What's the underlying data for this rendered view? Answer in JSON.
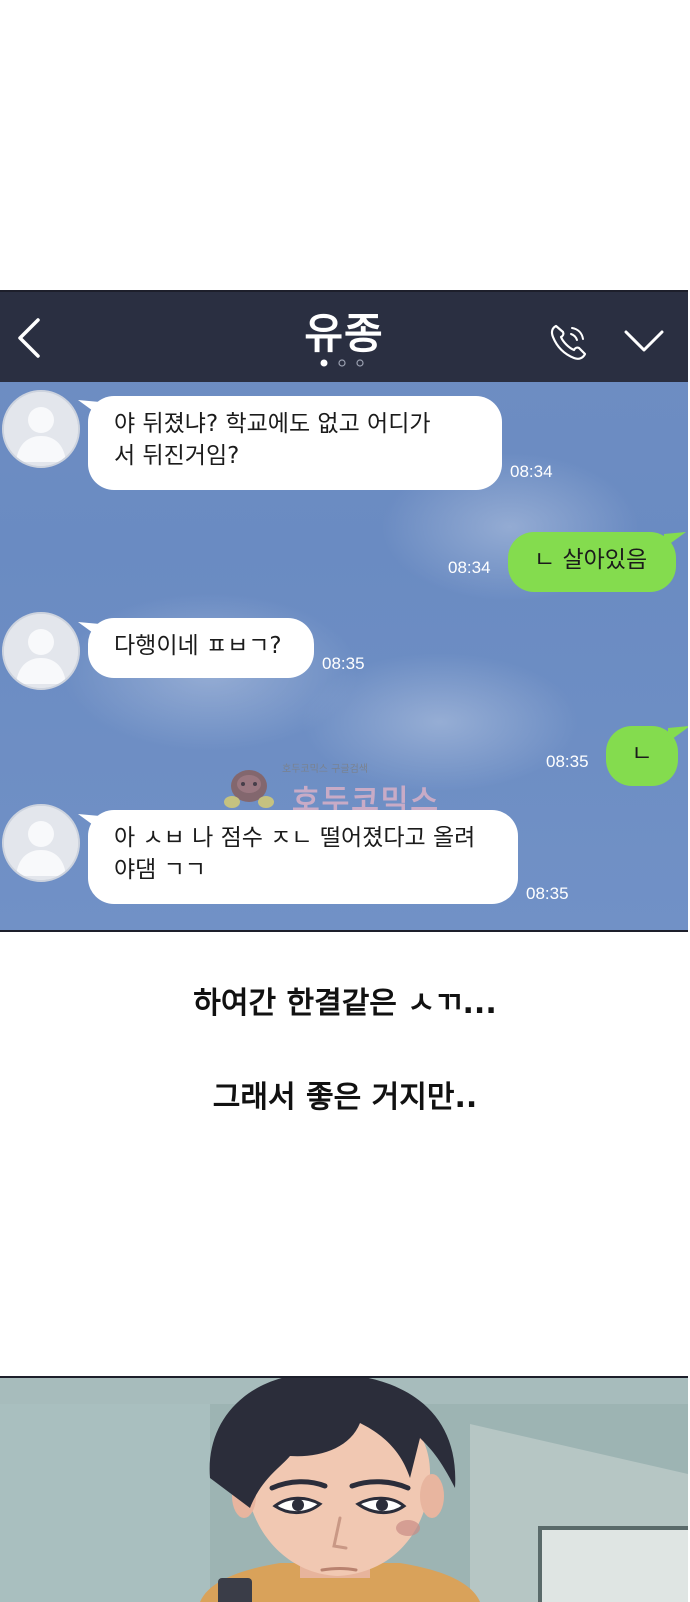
{
  "chat": {
    "title": "유종",
    "icons": {
      "back": "back-arrow-icon",
      "call": "phone-icon",
      "menu": "chevron-down-icon",
      "pages": "page-indicator-dots"
    },
    "messages": [
      {
        "side": "left",
        "text_lines": [
          "야 뒤졌냐? 학교에도 없고 어디가",
          "서 뒤진거임?"
        ],
        "time": "08:34"
      },
      {
        "side": "right",
        "text": "ㄴ 살아있음",
        "time": "08:34"
      },
      {
        "side": "left",
        "text": "다행이네 ㅍㅂㄱ?",
        "time": "08:35"
      },
      {
        "side": "right",
        "text": "ㄴ",
        "time": "08:35"
      },
      {
        "side": "left",
        "text_lines": [
          "아 ㅅㅂ 나 점수 ㅈㄴ 떨어졌다고 올려",
          "야댐  ㄱㄱ"
        ],
        "time": "08:35"
      }
    ],
    "colors": {
      "header": "#2a2f41",
      "background": "#6f8ec3",
      "incoming_bubble": "#ffffff",
      "outgoing_bubble": "#84dc4e"
    }
  },
  "watermark": {
    "small_text": "호두코믹스  구글검색",
    "big_text": "호두코믹스"
  },
  "narration": {
    "line1": "하여간 한결같은 ㅅㄲ...",
    "line2": "그래서 좋은 거지만.."
  }
}
